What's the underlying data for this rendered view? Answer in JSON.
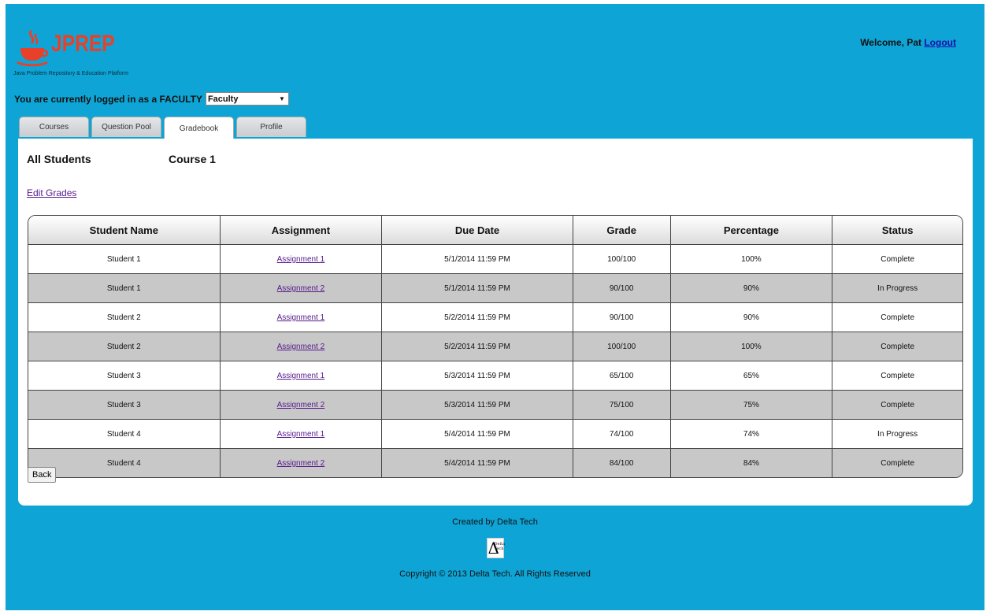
{
  "logo": {
    "name": "JPREP",
    "subtitle": "Java Problem Repository & Education Platform"
  },
  "header": {
    "welcome_prefix": "Welcome, Pat",
    "logout_label": "Logout",
    "role_text": "You are currently logged in as a FACULTY",
    "role_select_value": "Faculty"
  },
  "tabs": [
    {
      "label": "Courses"
    },
    {
      "label": "Question Pool"
    },
    {
      "label": "Gradebook"
    },
    {
      "label": "Profile"
    }
  ],
  "active_tab": "Gradebook",
  "page": {
    "scope": "All Students",
    "course": "Course 1",
    "edit_grades_label": "Edit Grades",
    "back_label": "Back"
  },
  "table": {
    "headers": [
      "Student Name",
      "Assignment",
      "Due Date",
      "Grade",
      "Percentage",
      "Status"
    ],
    "rows": [
      [
        "Student 1",
        "Assignment 1",
        "5/1/2014 11:59 PM",
        "100/100",
        "100%",
        "Complete"
      ],
      [
        "Student 1",
        "Assignment 2",
        "5/1/2014 11:59 PM",
        "90/100",
        "90%",
        "In Progress"
      ],
      [
        "Student 2",
        "Assignment 1",
        "5/2/2014 11:59 PM",
        "90/100",
        "90%",
        "Complete"
      ],
      [
        "Student 2",
        "Assignment 2",
        "5/2/2014 11:59 PM",
        "100/100",
        "100%",
        "Complete"
      ],
      [
        "Student 3",
        "Assignment 1",
        "5/3/2014 11:59 PM",
        "65/100",
        "65%",
        "Complete"
      ],
      [
        "Student 3",
        "Assignment 2",
        "5/3/2014 11:59 PM",
        "75/100",
        "75%",
        "Complete"
      ],
      [
        "Student 4",
        "Assignment 1",
        "5/4/2014 11:59 PM",
        "74/100",
        "74%",
        "In Progress"
      ],
      [
        "Student 4",
        "Assignment 2",
        "5/4/2014 11:59 PM",
        "84/100",
        "84%",
        "Complete"
      ]
    ]
  },
  "footer": {
    "created_by": "Created by Delta Tech",
    "logo_text": "Delta Tech",
    "copyright": "Copyright © 2013 Delta Tech. All Rights Reserved"
  },
  "colors": {
    "background": "#0ea5d6",
    "logo": "#e8402a",
    "link": "#551a8b",
    "alt_row": "#c8c8c8"
  }
}
